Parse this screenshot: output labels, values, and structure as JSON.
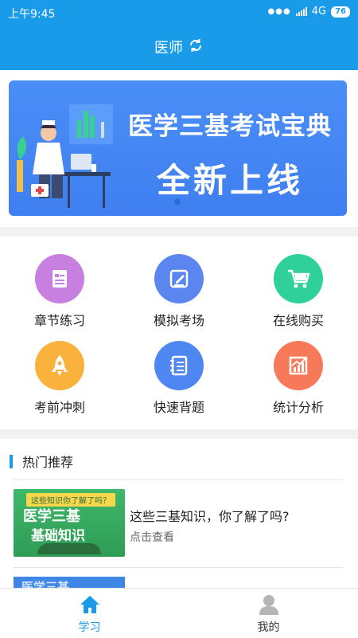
{
  "status_bar": {
    "time": "上午9:45",
    "network": "4G",
    "battery": "76"
  },
  "nav": {
    "title": "医师"
  },
  "banner": {
    "line1": "医学三基考试宝典",
    "line2": "全新上线"
  },
  "grid": {
    "items": [
      {
        "label": "章节练习",
        "icon": "document-icon",
        "color": "#c77fe0"
      },
      {
        "label": "模拟考场",
        "icon": "pencil-edit-icon",
        "color": "#5b86f0"
      },
      {
        "label": "在线购买",
        "icon": "shopping-cart-icon",
        "color": "#2fd09a"
      },
      {
        "label": "考前冲刺",
        "icon": "rocket-icon",
        "color": "#fbb23c"
      },
      {
        "label": "快速背题",
        "icon": "notebook-icon",
        "color": "#4e86f2"
      },
      {
        "label": "统计分析",
        "icon": "chart-icon",
        "color": "#f67a5a"
      }
    ]
  },
  "hot": {
    "title": "热门推荐",
    "articles": [
      {
        "thumb_tag": "这些知识你了解了吗？",
        "thumb_line1": "医学三基",
        "thumb_line2": "基础知识",
        "title": "这些三基知识，你了解了吗?",
        "subtitle": "点击查看"
      },
      {
        "thumb_line1": "医学三基"
      }
    ]
  },
  "tabbar": {
    "active_color": "#1a9bea",
    "tabs": [
      {
        "label": "学习",
        "icon": "home-icon"
      },
      {
        "label": "我的",
        "icon": "user-icon"
      }
    ]
  }
}
